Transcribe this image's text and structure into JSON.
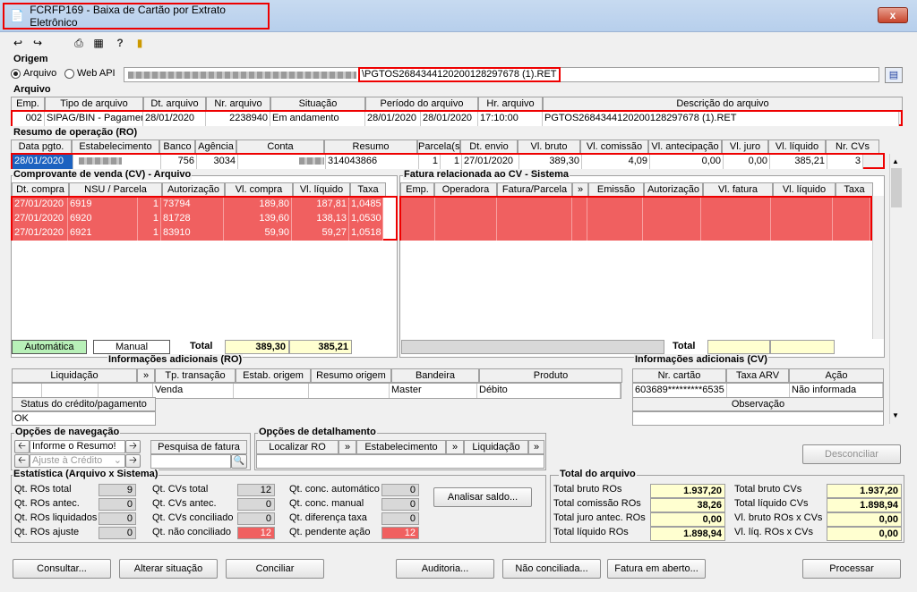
{
  "window": {
    "title": "FCRFP169 - Baixa de Cartão por Extrato Eletrônico",
    "close": "x"
  },
  "origem": {
    "label": "Origem",
    "radio_arquivo": "Arquivo",
    "radio_webapi": "Web API",
    "path": "\\PGTOS26843441202001282976​78 (1).RET"
  },
  "arquivo": {
    "label": "Arquivo",
    "headers": [
      "Emp.",
      "Tipo de arquivo",
      "Dt. arquivo",
      "Nr. arquivo",
      "Situação",
      "Período do arquivo",
      "Hr. arquivo",
      "Descrição do arquivo"
    ],
    "row": {
      "emp": "002",
      "tipo": "SIPAG/BIN - Pagamentos",
      "dt": "28/01/2020",
      "nr": "2238940",
      "situacao": "Em andamento",
      "periodo_ini": "28/01/2020",
      "periodo_fim": "28/01/2020",
      "hr": "17:10:00",
      "descricao": "PGTOS26843441202001282976​78 (1).RET"
    }
  },
  "ro": {
    "label": "Resumo de operação (RO)",
    "headers": [
      "Data pgto.",
      "Estabelecimento",
      "Banco",
      "Agência",
      "Conta",
      "Resumo",
      "Parcela(s)",
      "Dt. envio",
      "Vl. bruto",
      "Vl. comissão",
      "Vl. antecipação",
      "Vl. juro",
      "Vl. líquido",
      "Nr. CVs"
    ],
    "row": {
      "data": "28/01/2020",
      "banco": "756",
      "agencia": "3034",
      "resumo": "314043866",
      "parc1": "1",
      "parc2": "1",
      "envio": "27/01/2020",
      "bruto": "389,30",
      "comissao": "4,09",
      "antecipacao": "0,00",
      "juro": "0,00",
      "liquido": "385,21",
      "cvs": "3"
    }
  },
  "cv": {
    "label": "Comprovante de venda (CV) - Arquivo",
    "headers": [
      "Dt. compra",
      "NSU / Parcela",
      "Autorização",
      "Vl. compra",
      "Vl. líquido",
      "Taxa"
    ],
    "rows": [
      {
        "dt": "27/01/2020",
        "nsu": "6919",
        "parc": "1",
        "aut": "73794",
        "compra": "189,80",
        "liquido": "187,81",
        "taxa": "1,0485"
      },
      {
        "dt": "27/01/2020",
        "nsu": "6920",
        "parc": "1",
        "aut": "81728",
        "compra": "139,60",
        "liquido": "138,13",
        "taxa": "1,0530"
      },
      {
        "dt": "27/01/2020",
        "nsu": "6921",
        "parc": "1",
        "aut": "83910",
        "compra": "59,90",
        "liquido": "59,27",
        "taxa": "1,0518"
      }
    ],
    "automatica": "Automática",
    "manual": "Manual",
    "total_label": "Total",
    "total_compra": "389,30",
    "total_liquido": "385,21"
  },
  "fatura": {
    "label": "Fatura relacionada ao CV - Sistema",
    "headers": [
      "Emp.",
      "Operadora",
      "Fatura/Parcela",
      "»",
      "Emissão",
      "Autorização",
      "Vl. fatura",
      "Vl. líquido",
      "Taxa"
    ],
    "total_label": "Total"
  },
  "info_ro": {
    "label": "Informações adicionais (RO)",
    "headers": [
      "Liquidação",
      "»",
      "Tp. transação",
      "Estab. origem",
      "Resumo origem",
      "Bandeira",
      "Produto"
    ],
    "row": {
      "tp": "Venda",
      "bandeira": "Master",
      "produto": "Débito"
    },
    "status_label": "Status do crédito/pagamento",
    "status": "OK"
  },
  "info_cv": {
    "label": "Informações adicionais (CV)",
    "headers": [
      "Nr. cartão",
      "Taxa ARV",
      "Ação"
    ],
    "row": {
      "cartao": "603689*********6535",
      "taxa": "",
      "acao": "Não informada"
    },
    "obs_label": "Observação"
  },
  "nav": {
    "label": "Opções de navegação",
    "informe": "Informe o Resumo!",
    "ajuste": "Ajuste à Crédito",
    "pesquisa": "Pesquisa de fatura"
  },
  "detalhe": {
    "label": "Opções de detalhamento",
    "localizar": "Localizar RO",
    "estab": "Estabelecimento",
    "liquidacao": "Liquidação"
  },
  "desconciliar": "Desconciliar",
  "estat": {
    "label": "Estatística (Arquivo x Sistema)",
    "col1": [
      {
        "l": "Qt. ROs total",
        "v": "9"
      },
      {
        "l": "Qt. ROs antec.",
        "v": "0"
      },
      {
        "l": "Qt. ROs liquidados",
        "v": "0"
      },
      {
        "l": "Qt. ROs ajuste",
        "v": "0"
      }
    ],
    "col2": [
      {
        "l": "Qt. CVs total",
        "v": "12"
      },
      {
        "l": "Qt. CVs antec.",
        "v": "0"
      },
      {
        "l": "Qt. CVs conciliado",
        "v": "0"
      },
      {
        "l": "Qt. não conciliado",
        "v": "12"
      }
    ],
    "col3": [
      {
        "l": "Qt. conc. automático",
        "v": "0"
      },
      {
        "l": "Qt. conc. manual",
        "v": "0"
      },
      {
        "l": "Qt. diferença taxa",
        "v": "0"
      },
      {
        "l": "Qt. pendente ação",
        "v": "12"
      }
    ],
    "analisar": "Analisar saldo..."
  },
  "total_arquivo": {
    "label": "Total do arquivo",
    "left": [
      {
        "l": "Total bruto ROs",
        "v": "1.937,20"
      },
      {
        "l": "Total comissão ROs",
        "v": "38,26"
      },
      {
        "l": "Total juro antec. ROs",
        "v": "0,00"
      },
      {
        "l": "Total líquido ROs",
        "v": "1.898,94"
      }
    ],
    "right": [
      {
        "l": "Total bruto CVs",
        "v": "1.937,20"
      },
      {
        "l": "Total líquido CVs",
        "v": "1.898,94"
      },
      {
        "l": "Vl. bruto ROs x CVs",
        "v": "0,00"
      },
      {
        "l": "Vl. líq. ROs x CVs",
        "v": "0,00"
      }
    ]
  },
  "buttons": {
    "consultar": "Consultar...",
    "alterar": "Alterar situação",
    "conciliar": "Conciliar",
    "auditoria": "Auditoria...",
    "nao_conciliada": "Não conciliada...",
    "fatura_aberto": "Fatura em aberto...",
    "processar": "Processar"
  }
}
